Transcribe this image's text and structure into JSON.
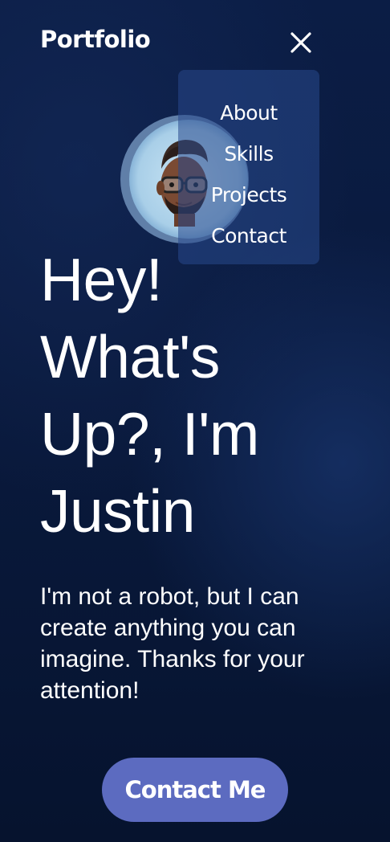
{
  "header": {
    "logo": "Portfolio",
    "close_icon": "close-icon"
  },
  "nav": {
    "items": [
      {
        "label": "About"
      },
      {
        "label": "Skills"
      },
      {
        "label": "Projects"
      },
      {
        "label": "Contact"
      }
    ]
  },
  "hero": {
    "avatar_icon": "memoji-avatar",
    "headline_lines": [
      "Hey!",
      "What's",
      "Up?, I'm",
      "Justin"
    ],
    "intro_lines": [
      "I'm not a robot, but I can",
      "create anything you can",
      "imagine. Thanks for your",
      "attention!"
    ],
    "cta_label": "Contact Me"
  },
  "colors": {
    "background": "#0a1a3e",
    "menu_bg": "#28488c",
    "cta_bg": "#5c6bc0",
    "text": "#ffffff"
  }
}
